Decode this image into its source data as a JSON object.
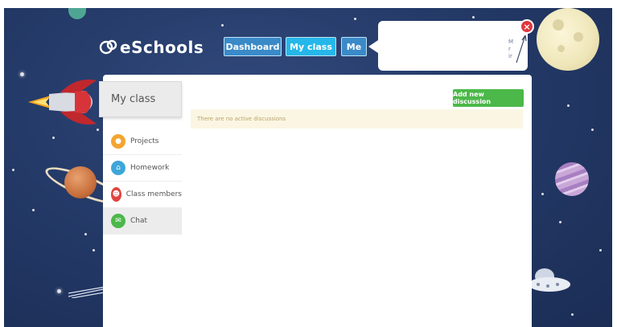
{
  "brand": {
    "name": "eSchools"
  },
  "nav": {
    "dashboard": "Dashboard",
    "my_class": "My class",
    "me": "Me"
  },
  "popup": {
    "text_fragments": [
      "M",
      "r",
      "ir"
    ]
  },
  "close": {
    "symbol": "×"
  },
  "sidebar": {
    "title": "My class",
    "items": [
      {
        "label": "Projects",
        "icon": "lightbulb-icon",
        "color": "#f3a531"
      },
      {
        "label": "Homework",
        "icon": "home-icon",
        "color": "#3ea6d8"
      },
      {
        "label": "Class members",
        "icon": "people-icon",
        "color": "#e0443f"
      },
      {
        "label": "Chat",
        "icon": "chat-icon",
        "color": "#4cb849",
        "active": true
      }
    ]
  },
  "main": {
    "add_button": "Add new discussion",
    "notice": "There are no active discussions"
  },
  "colors": {
    "background": "#243a68",
    "nav_blue": "#3b8ac8",
    "nav_active": "#26b7ea",
    "add_green": "#4cb849",
    "notice_bg": "#fbf6e3",
    "close_red": "#e0373f"
  }
}
